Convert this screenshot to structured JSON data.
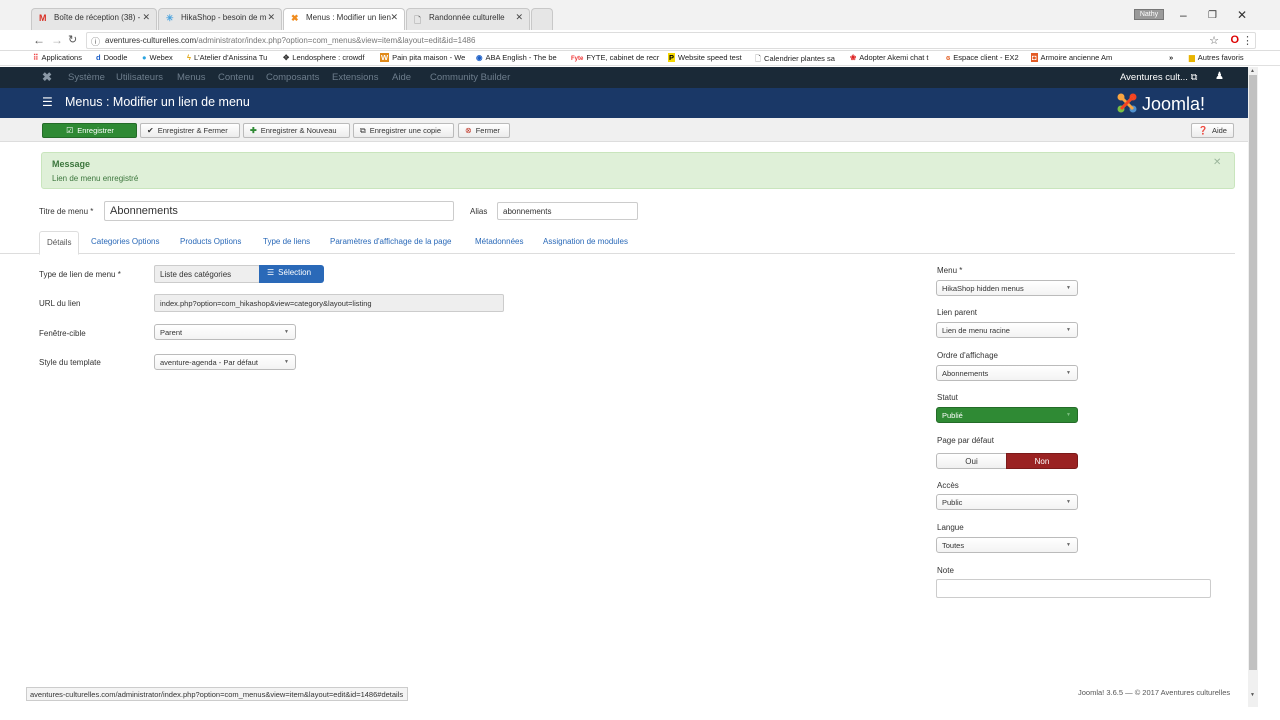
{
  "browser": {
    "tabs": [
      {
        "icon": "M",
        "title": "Boîte de réception (38) -"
      },
      {
        "icon": "✳",
        "title": "HikaShop - besoin de m"
      },
      {
        "icon": "✖",
        "title": "Menus : Modifier un lien"
      },
      {
        "icon": "🗋",
        "title": "Randonnée culturelle"
      }
    ],
    "user_badge": "Nathy",
    "url_host": "aventures-culturelles.com",
    "url_path": "/administrator/index.php?option=com_menus&view=item&layout=edit&id=1486",
    "bookmarks": [
      "Applications",
      "Doodle",
      "Webex",
      "L'Atelier d'Anissina Tu",
      "Lendosphere : crowdf",
      "Pain pita maison - We",
      "ABA English - The be",
      "FYTE, cabinet de recr",
      "Website speed test",
      "Calendrier plantes sa",
      "Adopter Akemi chat t",
      "Espace client - EX2",
      "Armoire ancienne Am"
    ],
    "bookmarks_overflow": "»",
    "other_bookmarks": "Autres favoris",
    "status_url": "aventures-culturelles.com/administrator/index.php?option=com_menus&view=item&layout=edit&id=1486#details"
  },
  "admin_nav": {
    "items": [
      "Système",
      "Utilisateurs",
      "Menus",
      "Contenu",
      "Composants",
      "Extensions",
      "Aide",
      "Community Builder"
    ],
    "site_name": "Aventures cult...",
    "external_icon": "⧉",
    "user_icon": "👤"
  },
  "header": {
    "title": "Menus : Modifier un lien de menu",
    "logo_text": "Joomla!"
  },
  "toolbar": {
    "save": "Enregistrer",
    "save_close": "Enregistrer & Fermer",
    "save_new": "Enregistrer & Nouveau",
    "save_copy": "Enregistrer une copie",
    "close": "Fermer",
    "help": "Aide"
  },
  "message": {
    "heading": "Message",
    "text": "Lien de menu enregistré"
  },
  "form": {
    "title_label": "Titre de menu *",
    "title_value": "Abonnements",
    "alias_label": "Alias",
    "alias_value": "abonnements",
    "tabs": [
      "Détails",
      "Categories Options",
      "Products Options",
      "Type de liens",
      "Paramètres d'affichage de la page",
      "Métadonnées",
      "Assignation de modules"
    ],
    "type_label": "Type de lien de menu *",
    "type_value": "Liste des catégories",
    "select_button": "Sélection",
    "url_label": "URL du lien",
    "url_value": "index.php?option=com_hikashop&view=category&layout=listing",
    "target_label": "Fenêtre-cible",
    "target_value": "Parent",
    "template_label": "Style du template",
    "template_value": "aventure-agenda - Par défaut"
  },
  "side": {
    "menu_label": "Menu *",
    "menu_value": "HikaShop hidden menus",
    "parent_label": "Lien parent",
    "parent_value": "Lien de menu racine",
    "order_label": "Ordre d'affichage",
    "order_value": "Abonnements",
    "status_label": "Statut",
    "status_value": "Publié",
    "default_label": "Page par défaut",
    "default_yes": "Oui",
    "default_no": "Non",
    "access_label": "Accès",
    "access_value": "Public",
    "language_label": "Langue",
    "language_value": "Toutes",
    "note_label": "Note",
    "note_value": ""
  },
  "footer": "Joomla! 3.6.5 — © 2017 Aventures culturelles",
  "colors": {
    "nav_bg": "#1a2937",
    "header_bg": "#1a3867",
    "save_green": "#2f8a34",
    "published_green": "#2f8a34",
    "no_red": "#9a2222",
    "message_bg": "#dff0d8",
    "link_blue": "#2a69b8"
  }
}
